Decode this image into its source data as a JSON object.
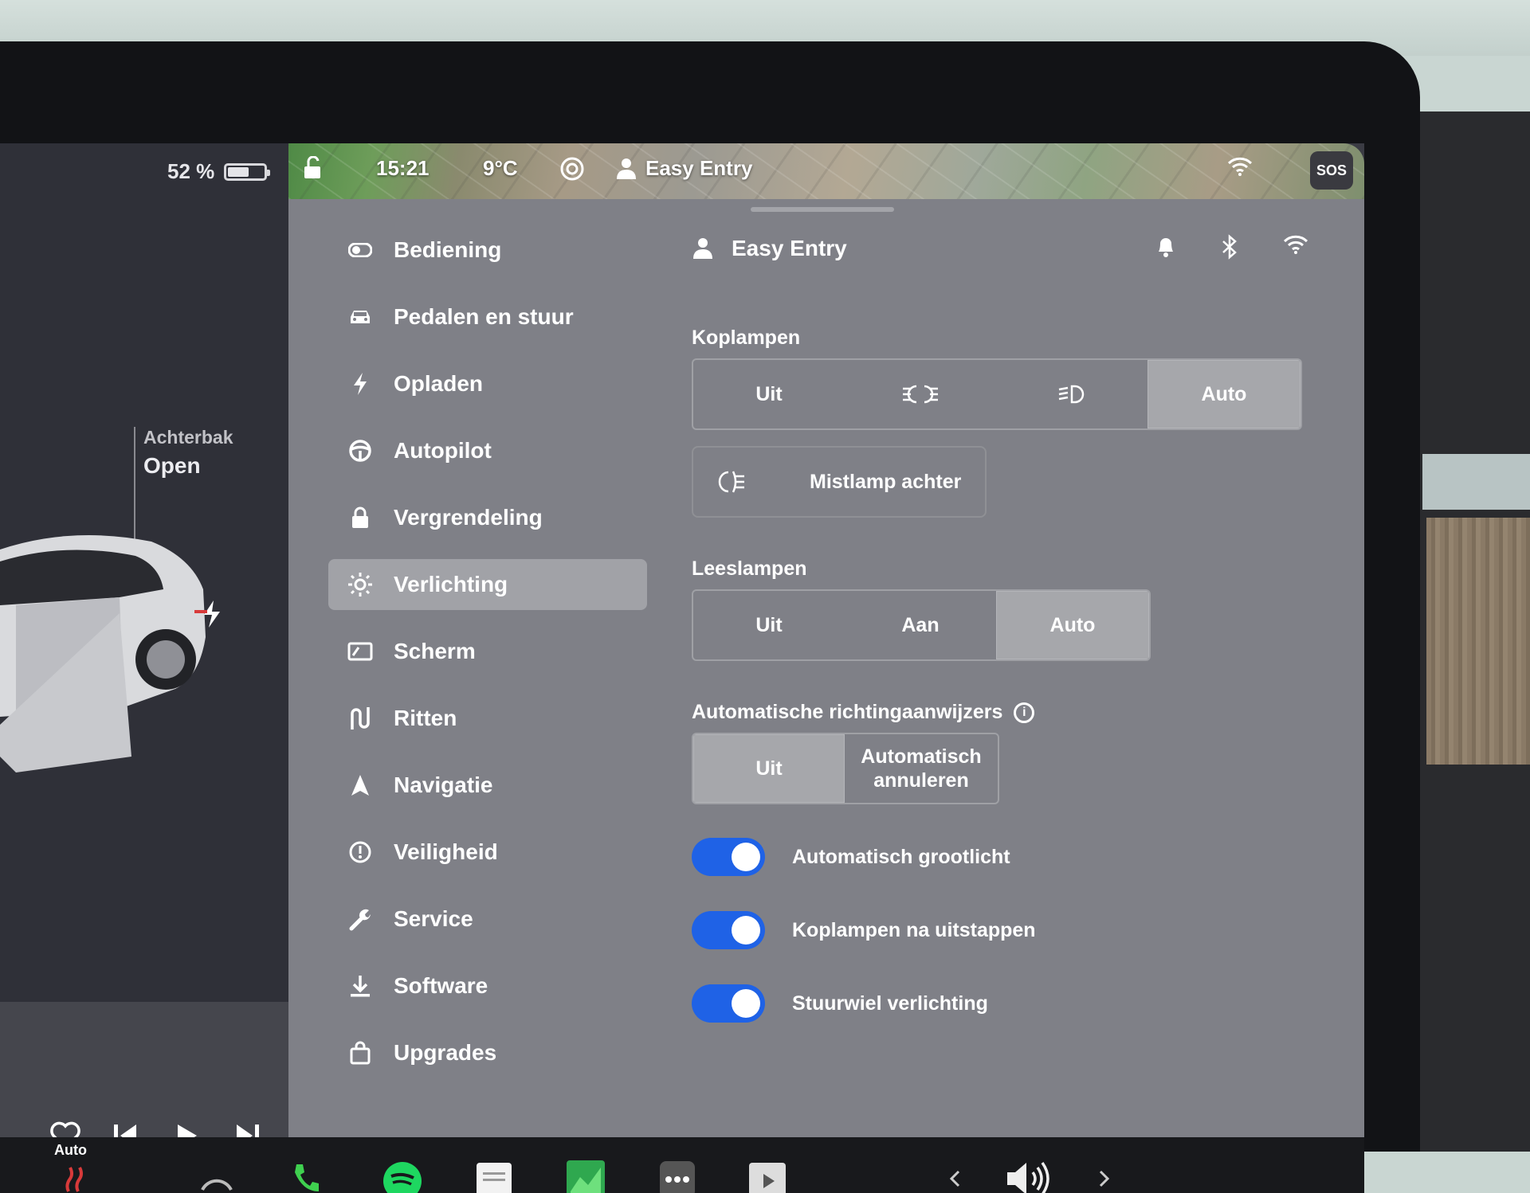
{
  "status_bar": {
    "time": "15:21",
    "temperature": "9°C",
    "profile_name": "Easy Entry",
    "sos_label": "SOS",
    "battery_percent": "52 %",
    "battery_level": 0.52
  },
  "car_panel": {
    "trunk_label": "Achterbak",
    "trunk_state": "Open"
  },
  "nav": {
    "items": [
      {
        "label": "Bediening",
        "icon": "toggle-icon"
      },
      {
        "label": "Pedalen en stuur",
        "icon": "car-icon"
      },
      {
        "label": "Opladen",
        "icon": "bolt-icon"
      },
      {
        "label": "Autopilot",
        "icon": "steering-wheel-icon"
      },
      {
        "label": "Vergrendeling",
        "icon": "lock-icon"
      },
      {
        "label": "Verlichting",
        "icon": "sun-icon"
      },
      {
        "label": "Scherm",
        "icon": "display-icon"
      },
      {
        "label": "Ritten",
        "icon": "trips-icon"
      },
      {
        "label": "Navigatie",
        "icon": "navigation-arrow-icon"
      },
      {
        "label": "Veiligheid",
        "icon": "alert-circle-icon"
      },
      {
        "label": "Service",
        "icon": "wrench-icon"
      },
      {
        "label": "Software",
        "icon": "download-icon"
      },
      {
        "label": "Upgrades",
        "icon": "shopping-bag-icon"
      }
    ],
    "active_label": "Verlichting"
  },
  "content": {
    "profile_name": "Easy Entry",
    "koplampen": {
      "title": "Koplampen",
      "options": [
        "Uit",
        "",
        "",
        "Auto"
      ],
      "option_icons": [
        "",
        "parking-lights-icon",
        "low-beam-icon",
        ""
      ],
      "selected": "Auto"
    },
    "mistlamp": {
      "label": "Mistlamp achter",
      "icon": "rear-fog-lamp-icon"
    },
    "leeslampen": {
      "title": "Leeslampen",
      "options": [
        "Uit",
        "Aan",
        "Auto"
      ],
      "selected": "Auto"
    },
    "richtingaanwijzers": {
      "title": "Automatische richtingaanwijzers",
      "options": [
        "Uit",
        "Automatisch annuleren"
      ],
      "selected": "Uit"
    },
    "toggles": [
      {
        "label": "Automatisch grootlicht",
        "on": true
      },
      {
        "label": "Koplampen na uitstappen",
        "on": true
      },
      {
        "label": "Stuurwiel verlichting",
        "on": true
      }
    ]
  },
  "bottom_bar": {
    "climate_label": "Auto"
  },
  "colors": {
    "toggle_on": "#1f62e6",
    "panel_bg": "#7f8087",
    "selected_segment": "#a6a7ab"
  }
}
